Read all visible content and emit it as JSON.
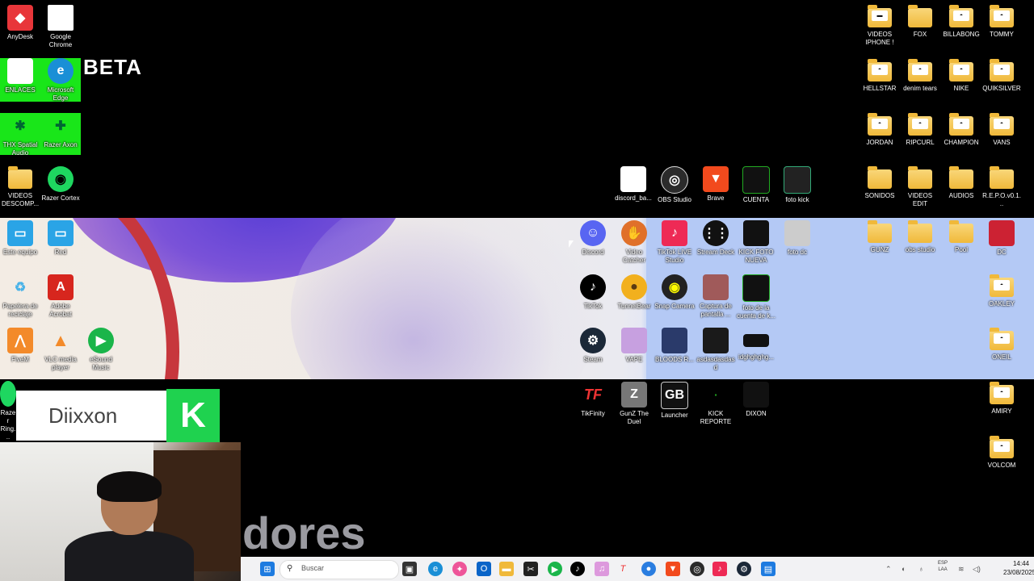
{
  "overlay": {
    "beta": "BETA",
    "streamer_name": "Diixxon",
    "kick_logo": "K",
    "partial_text": "dores"
  },
  "icons": {
    "anydesk": "AnyDesk",
    "chrome": "Google Chrome",
    "enlaces": "ENLACES",
    "edge": "Microsoft Edge",
    "thx": "THX Spatial Audio",
    "razer_axon": "Razer Axon",
    "videos_descomp": "VIDEOS DESCOMP...",
    "razer_cortex": "Razer Cortex",
    "este_equipo": "Este equipo",
    "red": "Red",
    "papelera": "Papelera de reciclaje",
    "acrobat": "Adobe Acrobat",
    "fivem": "FiveM",
    "vlc": "VLC media player",
    "esound": "eSound Music",
    "razer_ring": "Razer Ring...",
    "discord_file": "discord_ba...",
    "obs": "OBS Studio",
    "brave": "Brave",
    "cuenta": "CUENTA",
    "foto_kick": "foto kick",
    "discord": "Discord",
    "video_catcher": "Video Catcher",
    "tiktok_live": "TikTok LIVE Studio",
    "stream_deck": "Stream Deck",
    "kick_foto": "KICK FOTO NUEVA",
    "foto_dc": "foto dc",
    "tiktok": "TikTok",
    "tunnelbear": "TunnelBear",
    "snap_camera": "Snap Camera",
    "captura": "Captura de pantalla ...",
    "foto_cuenta": "foto de la cuenta de k...",
    "steam": "Steam",
    "vape": "VAPE",
    "bloods": "BLOODS R...",
    "asdas": "asdasdasdasd",
    "idg": "idghghghg...",
    "tikfinity": "TikFinity",
    "gunz": "GunZ The Duel",
    "launcher": "Launcher",
    "kick_reporte": "KICK REPORTE",
    "dixon": "DIXON",
    "videos_iphone": "VIDEOS IPHONE !",
    "fox": "FOX",
    "billabong": "BILLABONG",
    "tommy": "TOMMY",
    "hellstar": "HELLSTAR",
    "denim": "denim tears",
    "nike": "NIKE",
    "quiksilver": "QUIKSILVER",
    "jordan": "JORDAN",
    "ripcurl": "RIPCURL",
    "champion": "CHAMPION",
    "vans": "VANS",
    "sonidos": "SONIDOS",
    "videos_edit": "VIDEOS EDIT",
    "audios": "AUDIOS",
    "repo": "R.E.P.O.v0.1...",
    "gunz_folder": "GUNZ",
    "obs_studio_folder": "obs studio",
    "pool": "Pool",
    "dc": "DC",
    "oakley": "OAKLEY",
    "oneil": "ONEIL",
    "amiry": "AMIRY",
    "volcom": "VOLCOM"
  },
  "taskbar": {
    "search_placeholder": "Buscar",
    "lang_1": "ESP",
    "lang_2": "LAA",
    "time": "14:44",
    "date": "23/08/2025"
  },
  "colors": {
    "kick_green": "#1fd24f",
    "highlight_green": "#19e619",
    "taskbar_bg": "#f2f2f4"
  }
}
